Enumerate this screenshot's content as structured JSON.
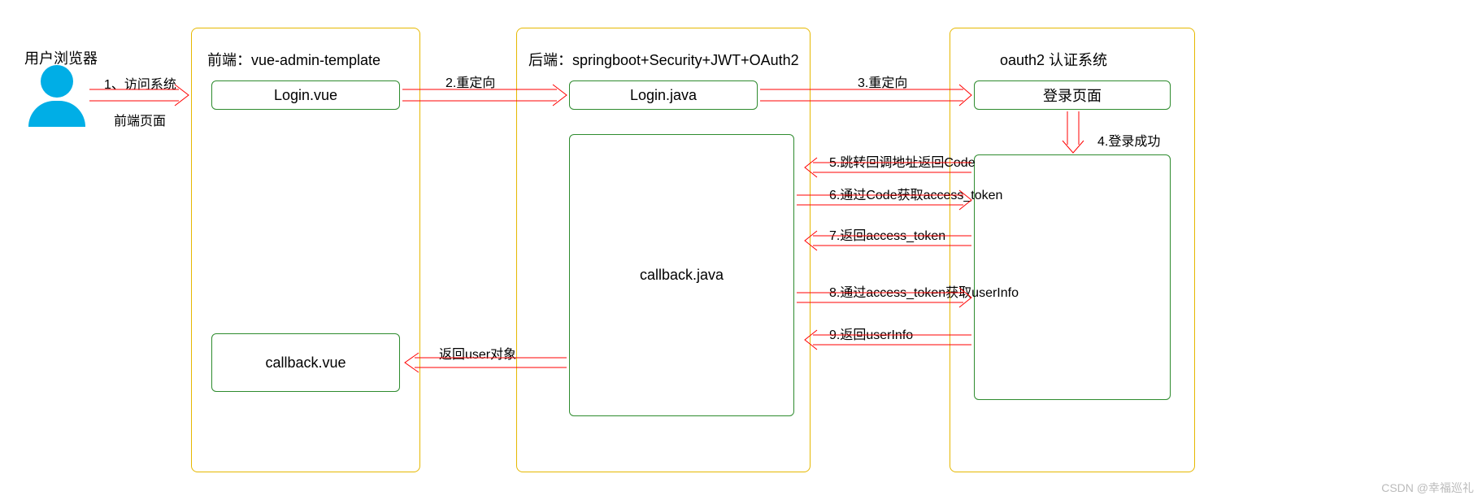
{
  "user_label": "用户浏览器",
  "frontend_title": "前端：vue-admin-template",
  "backend_title": "后端：springboot+Security+JWT+OAuth2",
  "oauth_title": "oauth2 认证系统",
  "nodes": {
    "login_vue": "Login.vue",
    "callback_vue": "callback.vue",
    "login_java": "Login.java",
    "callback_java": "callback.java",
    "login_page": "登录页面"
  },
  "arrows": {
    "a1_line1": "1、访问系统",
    "a1_line2": "前端页面",
    "a2": "2.重定向",
    "a3": "3.重定向",
    "a4": "4.登录成功",
    "a5": "5.跳转回调地址返回Code",
    "a6": "6.通过Code获取access_token",
    "a7": "7.返回access_token",
    "a8": "8.通过access_token获取userInfo",
    "a9": "9.返回userInfo",
    "return_user": "返回user对象"
  },
  "watermark": "CSDN @幸福巡礼"
}
